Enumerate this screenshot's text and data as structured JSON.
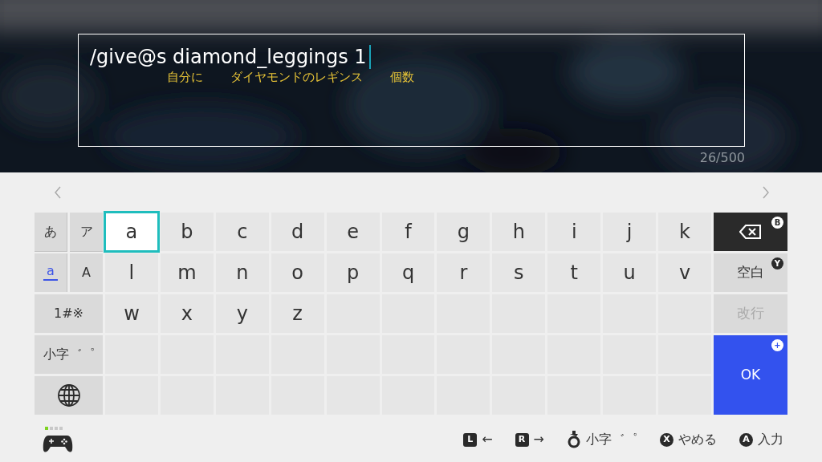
{
  "text_box": {
    "text": "/give@s diamond_leggings 1",
    "annotations": [
      "自分に",
      "ダイヤモンドのレギンス",
      "個数"
    ],
    "counter": "26/500"
  },
  "mode_keys": [
    {
      "label": "あ",
      "selected": false
    },
    {
      "label": "ア",
      "selected": false
    },
    {
      "label": "a",
      "selected": true
    },
    {
      "label": "A",
      "selected": false
    }
  ],
  "function_keys": [
    {
      "kind": "text",
      "label": "1#※"
    },
    {
      "kind": "text",
      "label": "小字゛゜"
    },
    {
      "kind": "globe"
    }
  ],
  "letter_rows": [
    [
      {
        "label": "a",
        "selected": true
      },
      {
        "label": "b",
        "selected": false
      },
      {
        "label": "c",
        "selected": false
      },
      {
        "label": "d",
        "selected": false
      },
      {
        "label": "e",
        "selected": false
      },
      {
        "label": "f",
        "selected": false
      },
      {
        "label": "g",
        "selected": false
      },
      {
        "label": "h",
        "selected": false
      },
      {
        "label": "i",
        "selected": false
      },
      {
        "label": "j",
        "selected": false
      },
      {
        "label": "k",
        "selected": false
      }
    ],
    [
      {
        "label": "l",
        "selected": false
      },
      {
        "label": "m",
        "selected": false
      },
      {
        "label": "n",
        "selected": false
      },
      {
        "label": "o",
        "selected": false
      },
      {
        "label": "p",
        "selected": false
      },
      {
        "label": "q",
        "selected": false
      },
      {
        "label": "r",
        "selected": false
      },
      {
        "label": "s",
        "selected": false
      },
      {
        "label": "t",
        "selected": false
      },
      {
        "label": "u",
        "selected": false
      },
      {
        "label": "v",
        "selected": false
      }
    ],
    [
      {
        "label": "w",
        "selected": false
      },
      {
        "label": "x",
        "selected": false
      },
      {
        "label": "y",
        "selected": false
      },
      {
        "label": "z",
        "selected": false
      }
    ]
  ],
  "action_keys": [
    {
      "kind": "backspace",
      "badge": "B",
      "disabled": false
    },
    {
      "kind": "text",
      "label": "空白",
      "badge": "Y",
      "disabled": false
    },
    {
      "kind": "text",
      "label": "改行",
      "disabled": true
    },
    {
      "kind": "confirm",
      "label": "OK",
      "badge": "+",
      "disabled": false
    }
  ],
  "hints": [
    {
      "kind": "shoulder",
      "button": "L",
      "label": "←"
    },
    {
      "kind": "shoulder",
      "button": "R",
      "label": "→"
    },
    {
      "kind": "stick",
      "label": "小字゛゜"
    },
    {
      "kind": "face",
      "button": "X",
      "label": "やめる"
    },
    {
      "kind": "face",
      "button": "A",
      "label": "入力"
    }
  ]
}
